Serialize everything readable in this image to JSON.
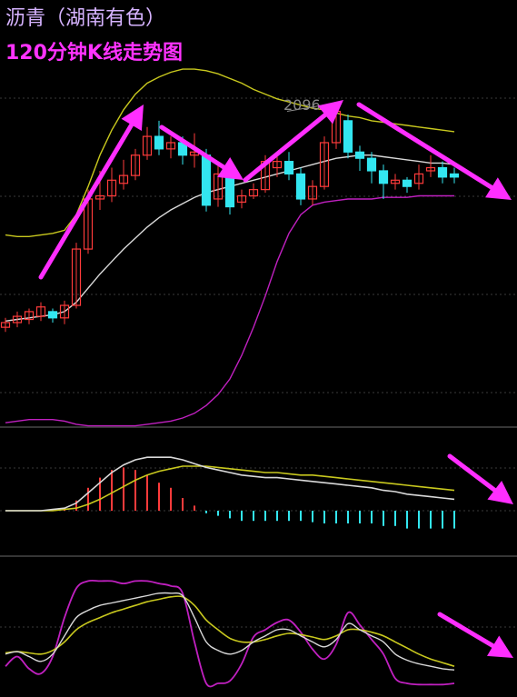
{
  "title": "沥青（湖南有色）",
  "subtitle": "120分钟K线走势图",
  "price_annotation": "2096",
  "colors": {
    "background": "#000000",
    "up": "#ff3b3b",
    "down": "#33e6f0",
    "mid": "#d9d9d9",
    "upper": "#c8c81e",
    "lower": "#c020c0",
    "arrow": "#ff2eff",
    "grid": "#3a3a3a"
  },
  "chart_data": [
    {
      "type": "candlestick",
      "name": "main",
      "ylim": [
        1900,
        2130
      ],
      "annotation": {
        "text": "2096",
        "index": 24,
        "value": 2096
      },
      "candles": [
        [
          1958,
          1961,
          1955,
          1964
        ],
        [
          1961,
          1965,
          1958,
          1968
        ],
        [
          1963,
          1968,
          1960,
          1970
        ],
        [
          1965,
          1971,
          1962,
          1974
        ],
        [
          1968,
          1964,
          1961,
          1970
        ],
        [
          1964,
          1972,
          1960,
          1975
        ],
        [
          1972,
          2008,
          1970,
          2012
        ],
        [
          2008,
          2040,
          2005,
          2046
        ],
        [
          2040,
          2042,
          2033,
          2058
        ],
        [
          2042,
          2052,
          2038,
          2060
        ],
        [
          2050,
          2055,
          2046,
          2065
        ],
        [
          2055,
          2068,
          2052,
          2072
        ],
        [
          2068,
          2080,
          2065,
          2086
        ],
        [
          2080,
          2072,
          2068,
          2090
        ],
        [
          2072,
          2076,
          2066,
          2080
        ],
        [
          2076,
          2068,
          2062,
          2080
        ],
        [
          2068,
          2070,
          2060,
          2082
        ],
        [
          2068,
          2036,
          2032,
          2072
        ],
        [
          2040,
          2056,
          2035,
          2062
        ],
        [
          2055,
          2035,
          2030,
          2058
        ],
        [
          2038,
          2042,
          2034,
          2046
        ],
        [
          2042,
          2046,
          2040,
          2050
        ],
        [
          2046,
          2064,
          2044,
          2068
        ],
        [
          2060,
          2064,
          2054,
          2070
        ],
        [
          2064,
          2056,
          2052,
          2070
        ],
        [
          2056,
          2040,
          2036,
          2060
        ],
        [
          2040,
          2048,
          2036,
          2052
        ],
        [
          2048,
          2076,
          2046,
          2080
        ],
        [
          2076,
          2096,
          2072,
          2100
        ],
        [
          2090,
          2070,
          2066,
          2094
        ],
        [
          2070,
          2066,
          2058,
          2074
        ],
        [
          2066,
          2058,
          2050,
          2070
        ],
        [
          2058,
          2050,
          2040,
          2062
        ],
        [
          2050,
          2052,
          2046,
          2056
        ],
        [
          2052,
          2048,
          2044,
          2054
        ],
        [
          2050,
          2056,
          2046,
          2062
        ],
        [
          2058,
          2060,
          2054,
          2068
        ],
        [
          2060,
          2054,
          2050,
          2064
        ],
        [
          2056,
          2054,
          2050,
          2060
        ]
      ],
      "bands": {
        "upper": [
          2017,
          2016,
          2016,
          2017,
          2018,
          2020,
          2030,
          2048,
          2068,
          2084,
          2097,
          2107,
          2114,
          2118,
          2121,
          2123,
          2123,
          2122,
          2120,
          2117,
          2114,
          2110,
          2107,
          2104,
          2102,
          2100,
          2098,
          2097,
          2095,
          2093,
          2092,
          2090,
          2089,
          2088,
          2087,
          2086,
          2085,
          2084,
          2083
        ],
        "mid": [
          1962,
          1963,
          1964,
          1965,
          1966,
          1968,
          1974,
          1983,
          1992,
          2000,
          2008,
          2015,
          2022,
          2028,
          2033,
          2037,
          2041,
          2044,
          2046,
          2048,
          2050,
          2052,
          2054,
          2056,
          2058,
          2060,
          2062,
          2064,
          2066,
          2067,
          2068,
          2068,
          2067,
          2066,
          2065,
          2064,
          2063,
          2063,
          2062
        ],
        "lower": [
          1897,
          1898,
          1899,
          1899,
          1899,
          1898,
          1896,
          1895,
          1895,
          1895,
          1895,
          1895,
          1896,
          1897,
          1898,
          1900,
          1903,
          1908,
          1915,
          1925,
          1940,
          1958,
          1978,
          2000,
          2018,
          2030,
          2036,
          2038,
          2039,
          2040,
          2040,
          2040,
          2041,
          2041,
          2041,
          2042,
          2042,
          2042,
          2042
        ]
      }
    },
    {
      "type": "bar+line",
      "name": "macd",
      "ylim": [
        -30,
        60
      ],
      "dif": [
        0,
        0,
        0,
        0,
        1,
        2,
        6,
        14,
        22,
        30,
        36,
        40,
        42,
        42,
        42,
        40,
        37,
        34,
        32,
        30,
        28,
        27,
        26,
        26,
        25,
        24,
        23,
        22,
        21,
        20,
        19,
        18,
        16,
        15,
        13,
        12,
        11,
        10,
        9
      ],
      "dea": [
        0,
        0,
        0,
        0,
        0,
        1,
        2,
        5,
        9,
        14,
        19,
        24,
        28,
        31,
        33,
        35,
        35,
        35,
        34,
        33,
        32,
        31,
        30,
        30,
        29,
        28,
        28,
        27,
        26,
        25,
        24,
        23,
        22,
        21,
        20,
        19,
        18,
        17,
        16
      ],
      "hist": [
        0,
        0,
        0,
        0,
        1,
        2,
        8,
        18,
        26,
        32,
        34,
        32,
        28,
        22,
        18,
        10,
        4,
        -2,
        -4,
        -6,
        -8,
        -8,
        -8,
        -8,
        -8,
        -8,
        -9,
        -10,
        -10,
        -10,
        -10,
        -10,
        -12,
        -12,
        -14,
        -14,
        -14,
        -14,
        -14
      ]
    },
    {
      "type": "line",
      "name": "oscillator",
      "ylim": [
        0,
        100
      ],
      "k": [
        30,
        32,
        28,
        24,
        30,
        45,
        60,
        66,
        70,
        72,
        74,
        76,
        78,
        80,
        80,
        78,
        60,
        40,
        33,
        30,
        33,
        40,
        45,
        50,
        50,
        45,
        40,
        36,
        42,
        55,
        50,
        45,
        40,
        30,
        25,
        22,
        20,
        18,
        17
      ],
      "d": [
        31,
        32,
        31,
        30,
        33,
        40,
        50,
        56,
        60,
        64,
        67,
        70,
        73,
        75,
        77,
        77,
        70,
        58,
        50,
        43,
        40,
        40,
        42,
        45,
        47,
        46,
        44,
        42,
        45,
        50,
        50,
        48,
        45,
        40,
        35,
        30,
        26,
        23,
        20
      ],
      "j": [
        20,
        28,
        18,
        14,
        28,
        60,
        84,
        90,
        90,
        90,
        88,
        90,
        90,
        88,
        86,
        80,
        40,
        6,
        6,
        8,
        22,
        44,
        50,
        56,
        58,
        48,
        34,
        26,
        38,
        64,
        54,
        42,
        30,
        10,
        6,
        5,
        5,
        5,
        6
      ]
    }
  ]
}
